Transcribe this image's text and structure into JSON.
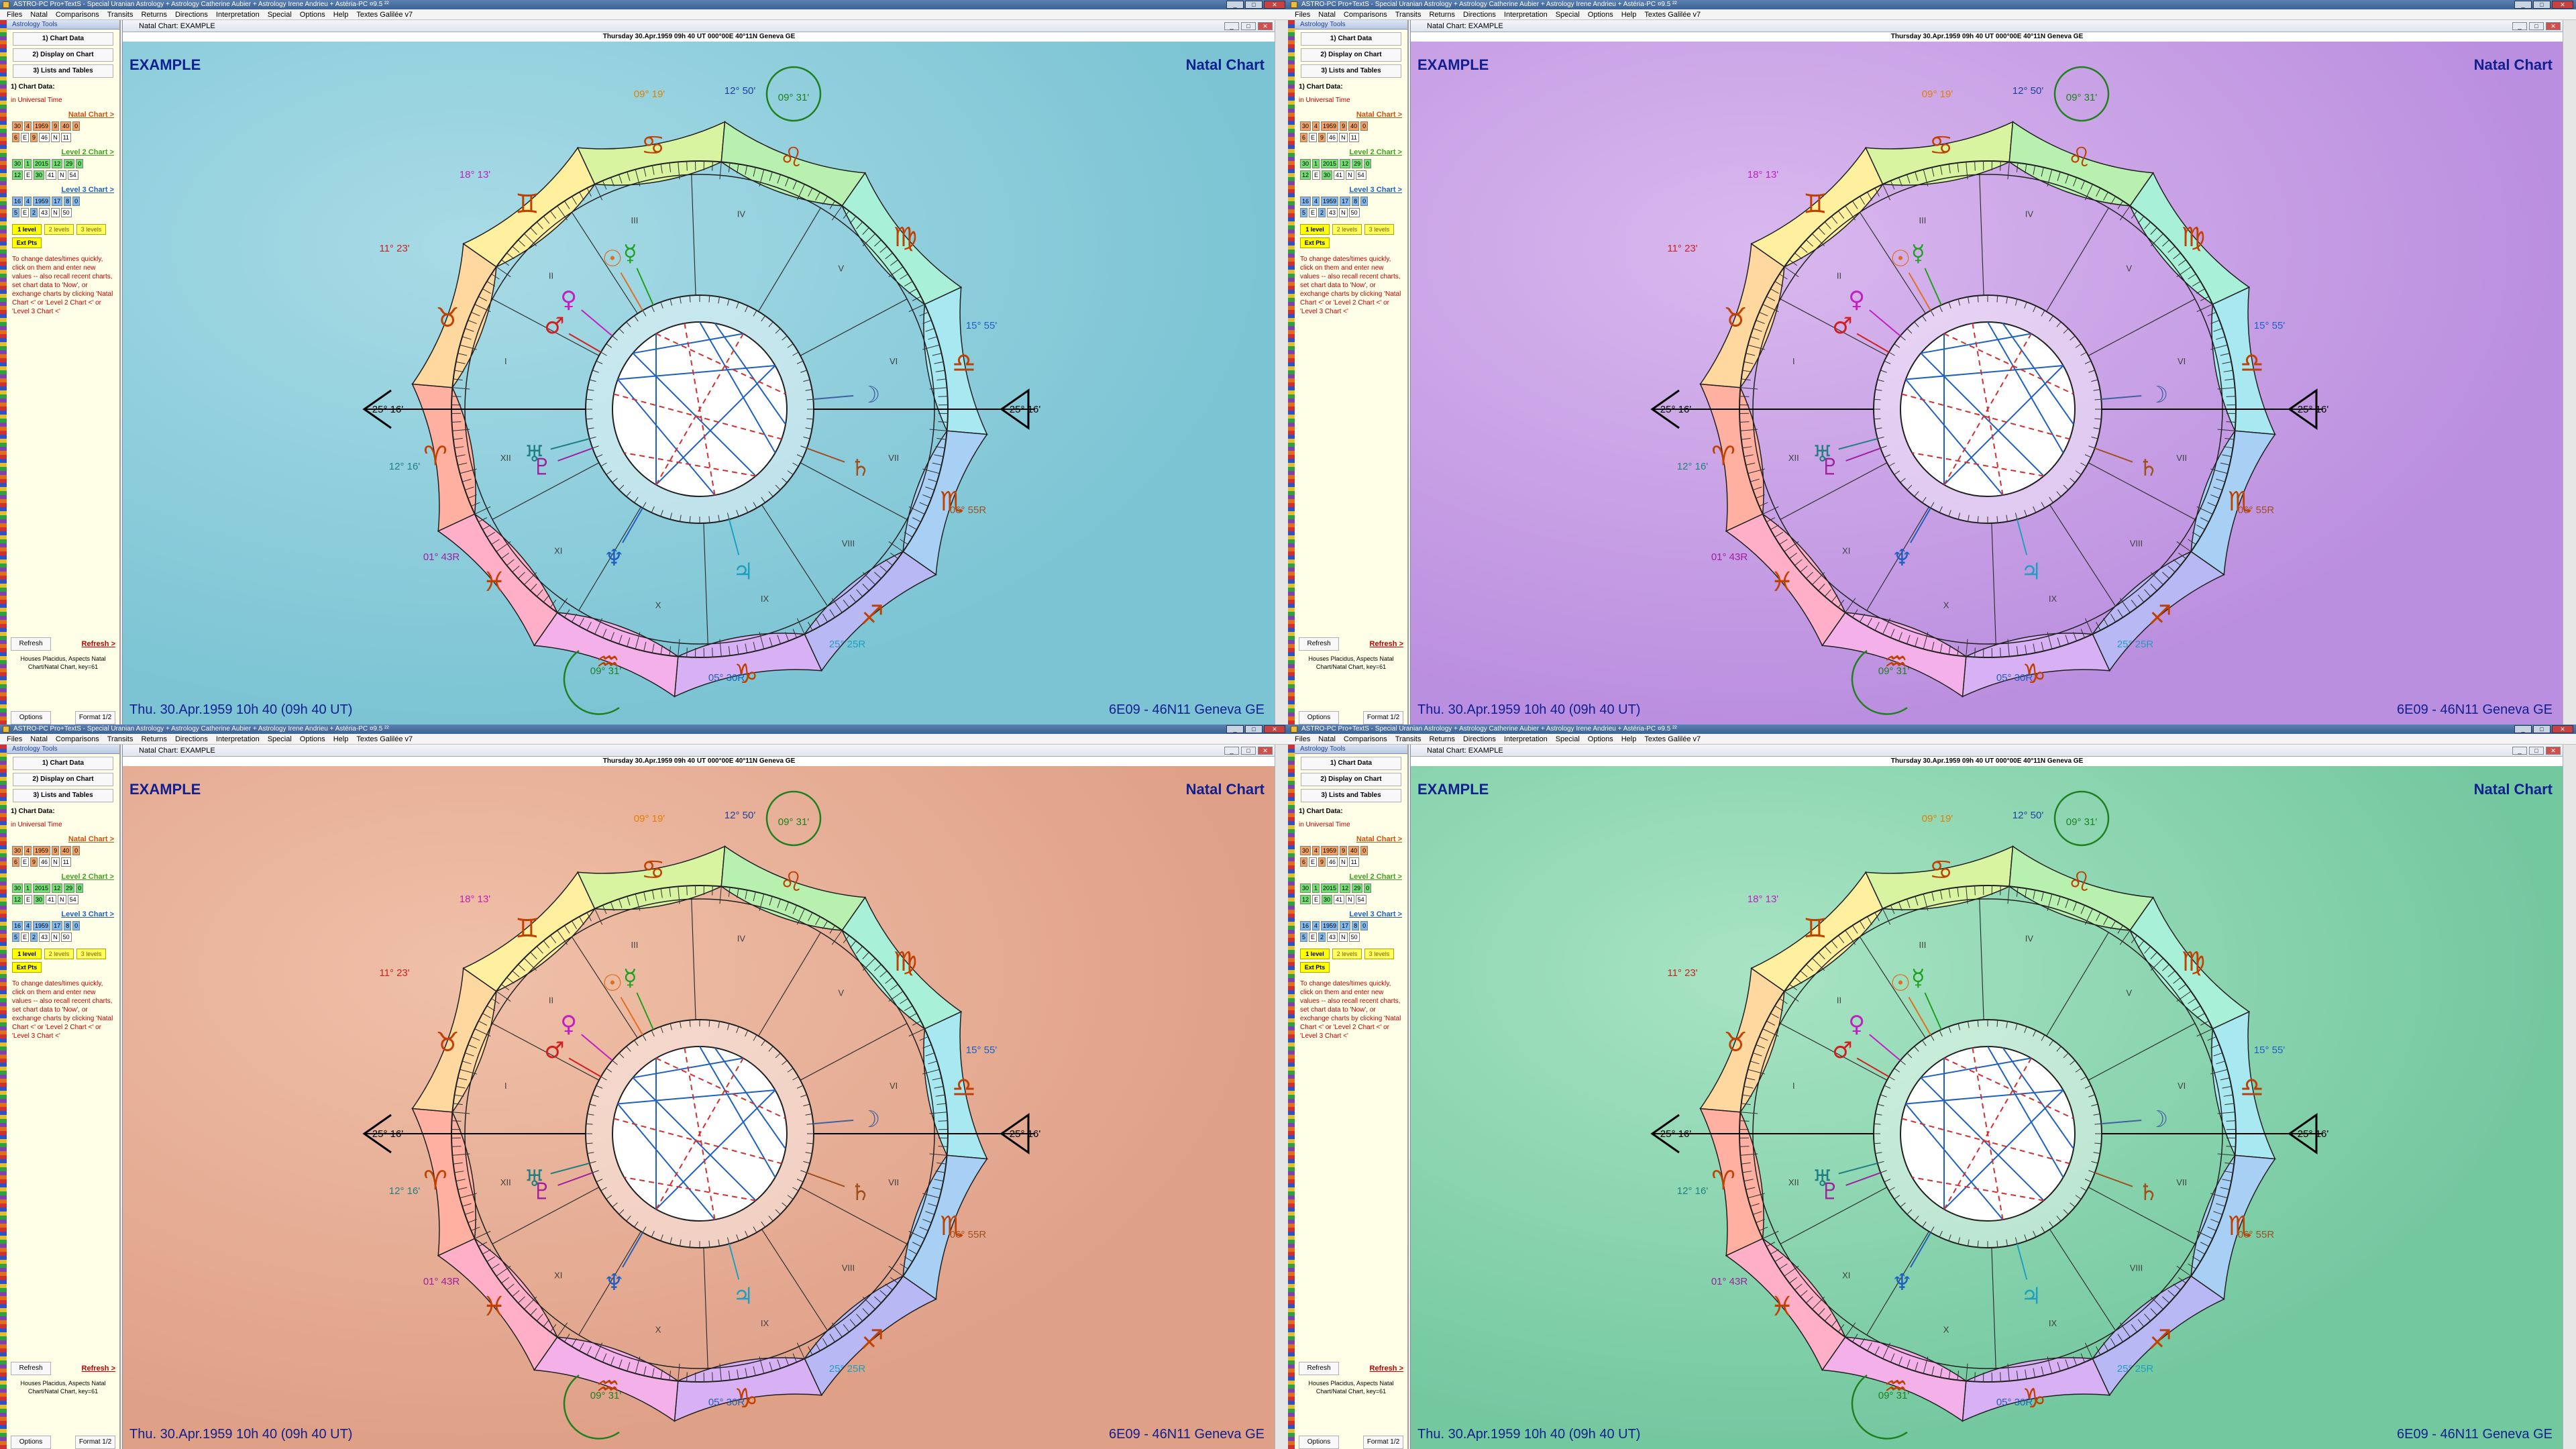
{
  "window": {
    "title": "ASTRO-PC Pro+TextS  -  Special Uranian Astrology  +  Astrology Catherine Aubier  +  Astrology Irene Andrieu  +  Astéria-PC ¤9.5 ²²",
    "menu": [
      "Files",
      "Natal",
      "Comparisons",
      "Transits",
      "Returns",
      "Directions",
      "Interpretation",
      "Special",
      "Options",
      "Help",
      "Textes Galilée v7"
    ]
  },
  "tools": {
    "header": "Astrology Tools",
    "buttons": [
      "1) Chart Data",
      "2) Display on Chart",
      "3) Lists and Tables"
    ],
    "section_label": "1) Chart Data:",
    "section_sub": "in Universal Time",
    "level1_label": "Natal Chart >",
    "level1_row1": [
      "30",
      "4",
      "1959",
      "9",
      "40",
      "0"
    ],
    "level1_row2": [
      "6",
      "E",
      "9",
      "46",
      "N",
      "11"
    ],
    "level2_label": "Level 2 Chart >",
    "level2_row1": [
      "30",
      "1",
      "2015",
      "12",
      "29",
      "0"
    ],
    "level2_row2": [
      "12",
      "E",
      "30",
      "41",
      "N",
      "54"
    ],
    "level3_label": "Level 3 Chart >",
    "level3_row1": [
      "16",
      "4",
      "1959",
      "17",
      "8",
      "0"
    ],
    "level3_row2": [
      "5",
      "E",
      "2",
      "43",
      "N",
      "50"
    ],
    "level_buttons": [
      "1 level",
      "2 levels",
      "3 levels"
    ],
    "ext_button": "Ext Pts",
    "help_text": "To change dates/times quickly, click on them and enter new values -- also recall recent charts, set chart data to 'Now', or exchange charts by clicking 'Natal Chart <' or 'Level 2 Chart <' or 'Level 3 Chart <'",
    "refresh_button": "Refresh",
    "refresh_link": "Refresh >",
    "footer_text": "Houses Placidus, Aspects Natal Chart/Natal Chart, key=61",
    "options_button": "Options",
    "format_button": "Format 1/2"
  },
  "chart_window": {
    "title": "Natal Chart: EXAMPLE",
    "dateline": "Thursday 30.Apr.1959 09h 40 UT 000°00E 40°11N  Geneva GE",
    "top_left": "EXAMPLE",
    "top_right": "Natal Chart",
    "bottom_left": "Thu. 30.Apr.1959 10h 40 (09h 40 UT)",
    "bottom_right": "6E09 - 46N11  Geneva GE"
  },
  "chart_labels": {
    "asc": "25° 16'",
    "mc_deg": "12° 50'",
    "ic_deg": "12° 50'",
    "l1": "09° 19'",
    "l2": "09° 31'",
    "l3": "18° 13'",
    "l4": "11° 23'",
    "l5": "12° 16'",
    "l6": "01° 43R",
    "l7": "15° 55'",
    "l8": "06° 55R",
    "l9": "25° 25R",
    "l10": "05° 30R",
    "l11": "09° 31'",
    "houses": [
      "I",
      "II",
      "III",
      "IV",
      "V",
      "VI",
      "VII",
      "VIII",
      "IX",
      "X",
      "XI",
      "XII"
    ]
  },
  "variants": [
    {
      "name": "blue",
      "bg1": "#a8dbe6",
      "bg2": "#7cc4d4"
    },
    {
      "name": "purple",
      "bg1": "#d9b8ee",
      "bg2": "#bb8fdf"
    },
    {
      "name": "peach",
      "bg1": "#f0c0a8",
      "bg2": "#dfa088"
    },
    {
      "name": "green",
      "bg1": "#a8e4c4",
      "bg2": "#74c8a0"
    }
  ],
  "zodiac_colors": [
    "#ffb0a0",
    "#ffd8a0",
    "#fff0a0",
    "#d8f4a0",
    "#b8f0b0",
    "#a8f0d8",
    "#a8e8f0",
    "#a8d0f4",
    "#b8b8f4",
    "#d8b0f4",
    "#f4b0e8",
    "#ffb0c8"
  ],
  "zodiac_glyphs": [
    "♈",
    "♉",
    "♊",
    "♋",
    "♌",
    "♍",
    "♎",
    "♏",
    "♐",
    "♑",
    "♒",
    "♓"
  ],
  "planets": [
    {
      "glyph": "☉",
      "color": "#e07020"
    },
    {
      "glyph": "♀",
      "color": "#c020c0"
    },
    {
      "glyph": "♂",
      "color": "#d02020"
    },
    {
      "glyph": "☿",
      "color": "#20a020"
    },
    {
      "glyph": "♃",
      "color": "#20a0c0"
    },
    {
      "glyph": "♄",
      "color": "#a05020"
    },
    {
      "glyph": "♅",
      "color": "#208080"
    },
    {
      "glyph": "♆",
      "color": "#2060c0"
    },
    {
      "glyph": "♇",
      "color": "#a020a0"
    },
    {
      "glyph": "☽",
      "color": "#4060a0"
    }
  ]
}
